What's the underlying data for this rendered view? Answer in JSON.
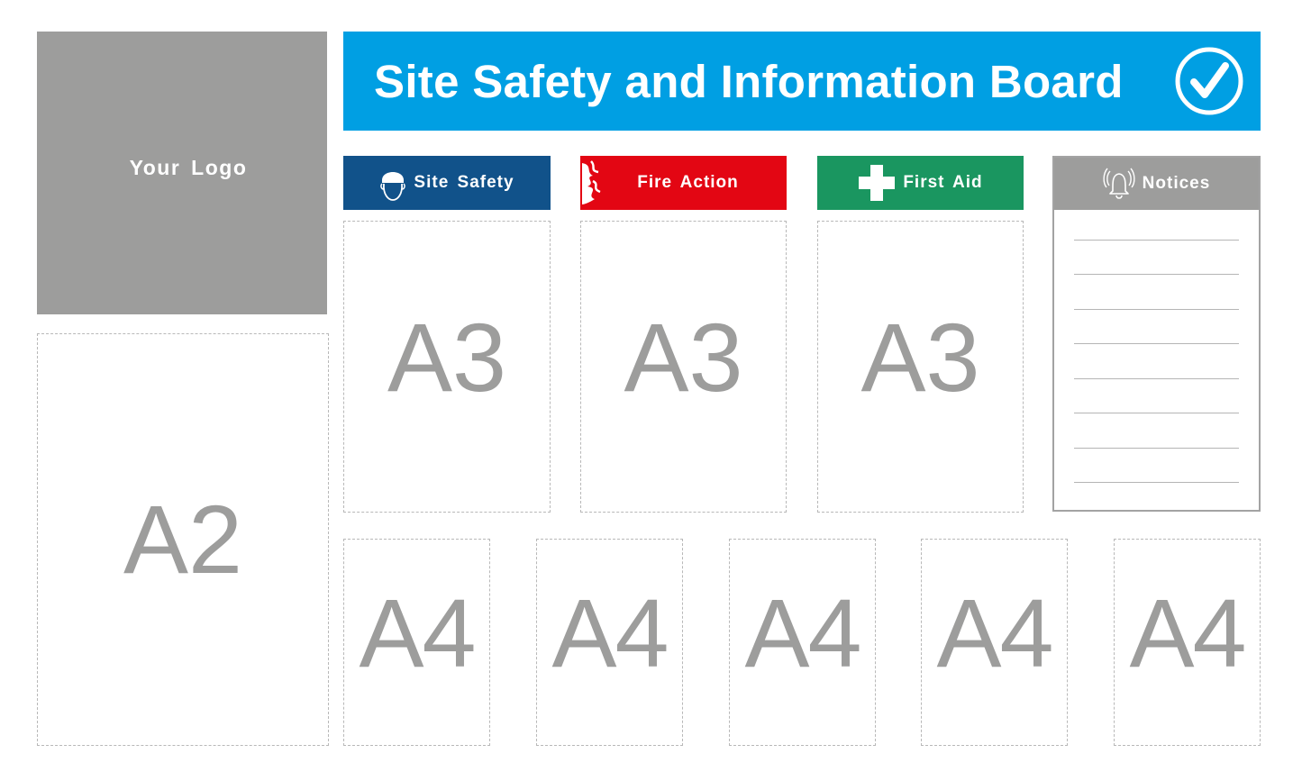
{
  "logo": {
    "label": "Your Logo"
  },
  "header": {
    "title": "Site Safety and Information Board",
    "icon": "check-circle-icon"
  },
  "sections": [
    {
      "label": "Site Safety",
      "icon": "hard-hat-icon",
      "color": "#11528a",
      "slot": "A3"
    },
    {
      "label": "Fire Action",
      "icon": "flame-icon",
      "color": "#e30613",
      "slot": "A3"
    },
    {
      "label": "First Aid",
      "icon": "cross-icon",
      "color": "#1a9660",
      "slot": "A3"
    },
    {
      "label": "Notices",
      "icon": "bell-icon",
      "color": "#9d9d9c",
      "lines": 8
    }
  ],
  "slots": {
    "large": "A2",
    "bottom": [
      "A4",
      "A4",
      "A4",
      "A4",
      "A4"
    ]
  },
  "colors": {
    "brand_blue": "#009fe3",
    "placeholder_gray": "#9d9d9c"
  }
}
